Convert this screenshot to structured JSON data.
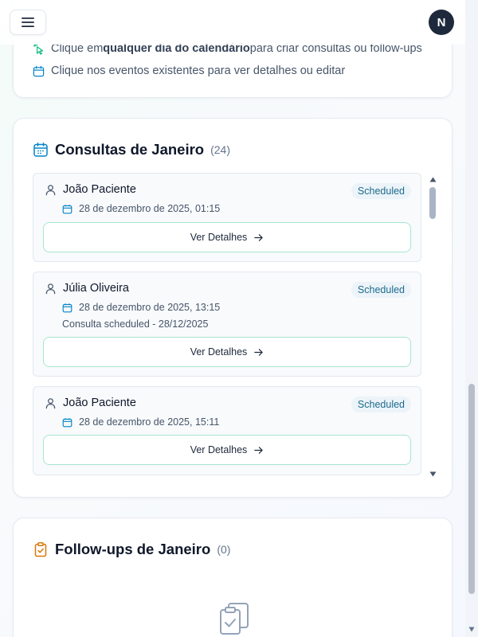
{
  "header": {
    "avatar_initial": "N"
  },
  "tips": {
    "tip1_prefix": "Clique em ",
    "tip1_bold": "qualquer dia do calendário",
    "tip1_suffix": " para criar consultas ou follow-ups",
    "tip2": "Clique nos eventos existentes para ver detalhes ou editar"
  },
  "appointments": {
    "title": "Consultas de Janeiro",
    "count": "(24)",
    "details_label": "Ver Detalhes",
    "items": [
      {
        "name": "João Paciente",
        "status": "Scheduled",
        "date": "28 de dezembro de 2025, 01:15",
        "note": ""
      },
      {
        "name": "Júlia Oliveira",
        "status": "Scheduled",
        "date": "28 de dezembro de 2025, 13:15",
        "note": "Consulta scheduled - 28/12/2025"
      },
      {
        "name": "João Paciente",
        "status": "Scheduled",
        "date": "28 de dezembro de 2025, 15:11",
        "note": ""
      }
    ]
  },
  "followups": {
    "title": "Follow-ups de Janeiro",
    "count": "(0)"
  },
  "colors": {
    "accent_green": "#10b981",
    "accent_blue": "#0284c7",
    "accent_orange": "#d97706",
    "badge_text": "#1e6a8c"
  }
}
